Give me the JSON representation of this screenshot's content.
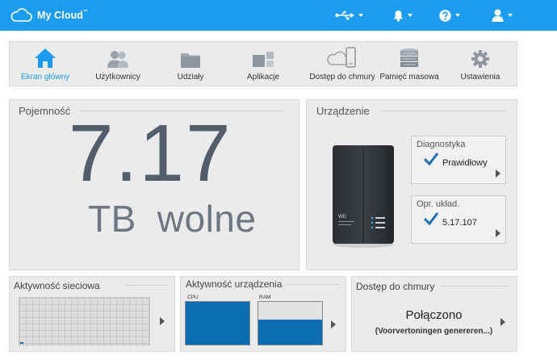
{
  "header": {
    "brand": "My Cloud",
    "brand_mark": "™",
    "icons": [
      "usb-icon",
      "bell-icon",
      "help-icon",
      "user-icon"
    ]
  },
  "nav": {
    "items": [
      {
        "label": "Ekran główny",
        "icon": "home-icon",
        "active": true
      },
      {
        "label": "Użytkownicy",
        "icon": "users-icon",
        "active": false
      },
      {
        "label": "Udziały",
        "icon": "folder-icon",
        "active": false
      },
      {
        "label": "Aplikacje",
        "icon": "apps-icon",
        "active": false
      },
      {
        "label": "Dostęp do chmury",
        "icon": "cloud-device-icon",
        "active": false
      },
      {
        "label": "Pamięć masowa",
        "icon": "storage-icon",
        "active": false
      },
      {
        "label": "Ustawienia",
        "icon": "gear-icon",
        "active": false
      }
    ]
  },
  "capacity": {
    "title": "Pojemność",
    "value": "7.17",
    "unit": "TB",
    "label": "wolne"
  },
  "device": {
    "title": "Urządzenie",
    "diagnostics": {
      "title": "Diagnostyka",
      "value": "Prawidłowy"
    },
    "firmware": {
      "title": "Opr. układ.",
      "value": "5.17.107"
    }
  },
  "network": {
    "title": "Aktywność sieciowa"
  },
  "device_activity": {
    "title": "Aktywność urządzenia",
    "cpu_label": "CPU",
    "ram_label": "RAM",
    "cpu_usage": 1.0,
    "ram_usage": 0.58
  },
  "cloud": {
    "title": "Dostęp do chmury",
    "status": "Połączono",
    "detail": "(Voorvertoningen genereren...)"
  },
  "colors": {
    "accent": "#1b9cf0",
    "meter_fill": "#0d6db3",
    "check": "#1e6fb5"
  }
}
